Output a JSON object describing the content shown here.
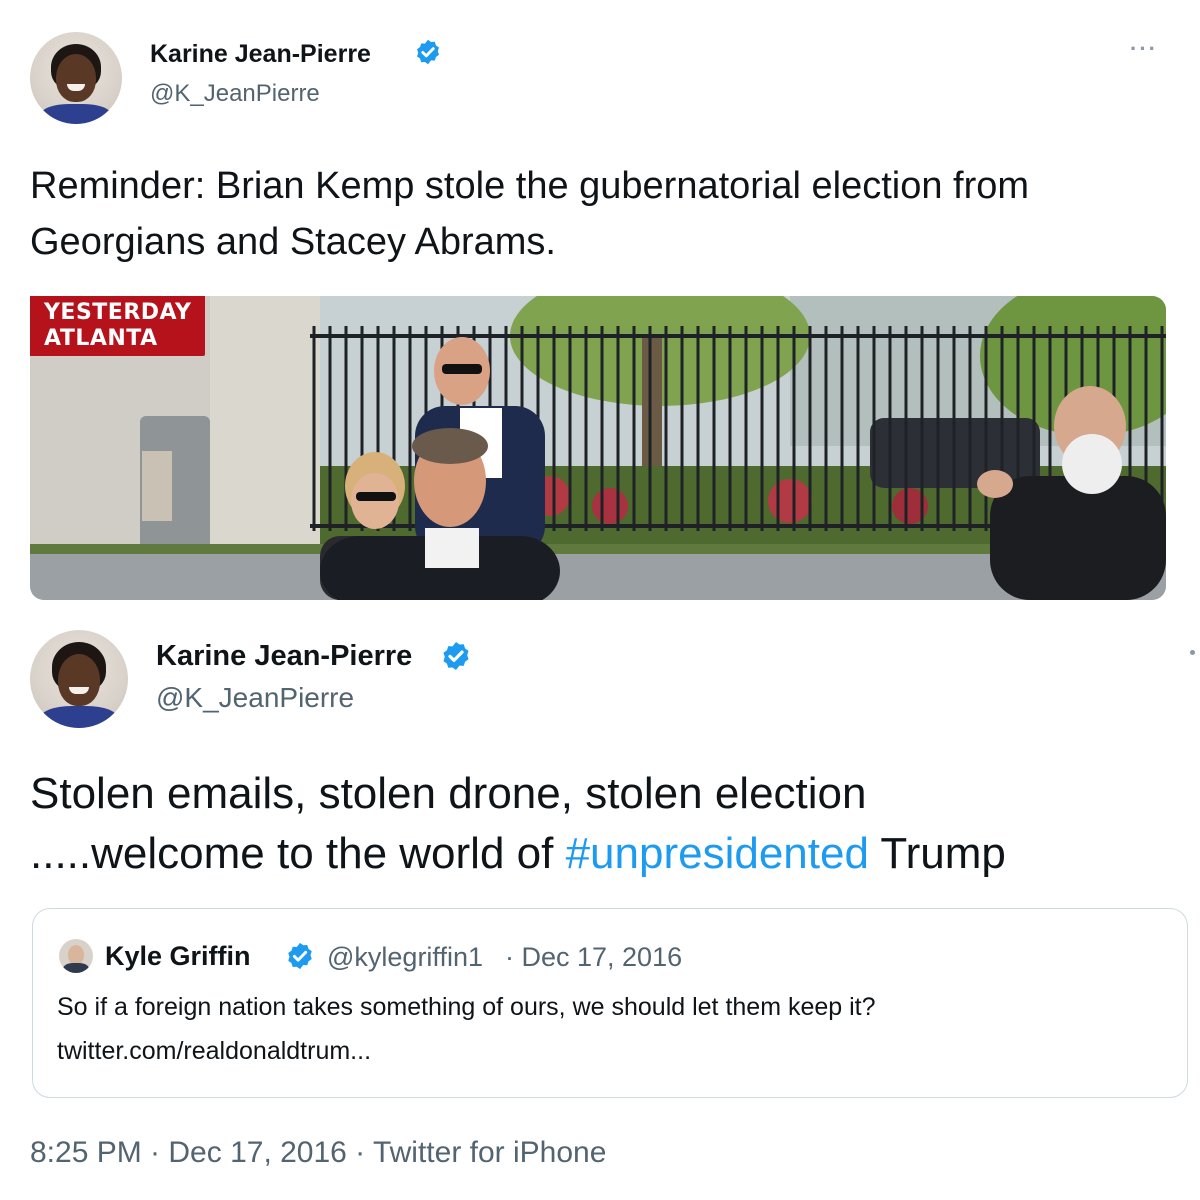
{
  "tweet1": {
    "author_name": "Karine Jean-Pierre",
    "author_handle": "@K_JeanPierre",
    "text": "Reminder: Brian Kemp stole the gubernatorial election from  Georgians and Stacey Abrams.",
    "media": {
      "badge_line1": "YESTERDAY",
      "badge_line2": "ATLANTA"
    },
    "more_icon": "more-horizontal-icon"
  },
  "tweet2": {
    "author_name": "Karine Jean-Pierre",
    "author_handle": "@K_JeanPierre",
    "text_line1": "Stolen emails, stolen drone, stolen election",
    "text_prefix": ".....welcome to the world of ",
    "hashtag": "#unpresidented",
    "text_suffix": " Trump",
    "quoted": {
      "author_name": "Kyle Griffin",
      "author_handle": "@kylegriffin1",
      "date": "· Dec 17, 2016",
      "text": "So if a foreign nation takes something of ours, we should let them keep it?",
      "link": "twitter.com/realdonaldtrum..."
    },
    "meta": "8:25 PM · Dec 17, 2016 · Twitter for iPhone"
  },
  "colors": {
    "verified": "#1d9bf0",
    "hashtag": "#1d9bf0",
    "secondary_text": "#536471",
    "badge": "#b5121b"
  }
}
